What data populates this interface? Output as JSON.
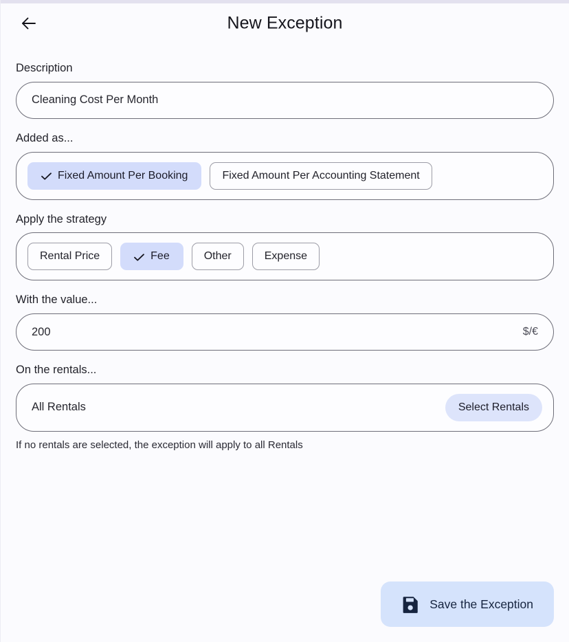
{
  "header": {
    "back_icon": "arrow-left-icon",
    "title": "New Exception"
  },
  "form": {
    "description": {
      "label": "Description",
      "value": "Cleaning Cost Per Month",
      "placeholder": "Description"
    },
    "added_as": {
      "label": "Added as...",
      "options": [
        {
          "label": "Fixed Amount Per Booking",
          "selected": true
        },
        {
          "label": "Fixed Amount Per Accounting Statement",
          "selected": false
        }
      ]
    },
    "strategy": {
      "label": "Apply the strategy",
      "options": [
        {
          "label": "Rental Price",
          "selected": false
        },
        {
          "label": "Fee",
          "selected": true
        },
        {
          "label": "Other",
          "selected": false
        },
        {
          "label": "Expense",
          "selected": false
        }
      ]
    },
    "value": {
      "label": "With the value...",
      "value": "200",
      "placeholder": "0",
      "suffix": "$/€"
    },
    "rentals": {
      "label": "On the rentals...",
      "summary": "All Rentals",
      "select_button": "Select Rentals",
      "helper": "If no rentals are selected, the exception will apply to all Rentals"
    }
  },
  "footer": {
    "save_label": "Save the Exception",
    "save_icon": "floppy-disk-save-icon"
  },
  "colors": {
    "page_background": "#fbfbfe",
    "top_bar": "#e3e1ef",
    "selected_chip": "#d3dcfb",
    "select_rentals_button": "#dde4fb",
    "save_button": "#d5e3fc",
    "save_icon": "#16243f",
    "border": "#6d6d78"
  }
}
